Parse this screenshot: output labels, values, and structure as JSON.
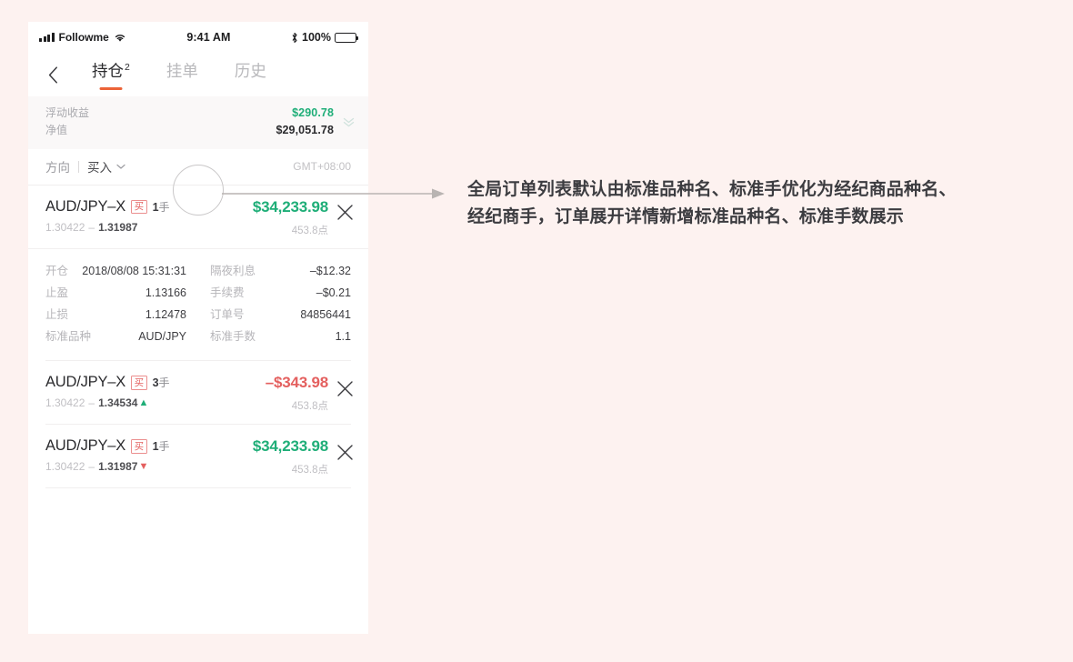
{
  "statusbar": {
    "carrier": "Followme",
    "time": "9:41 AM",
    "battery_percent": "100%",
    "signal_icon": "signal-bars-icon",
    "wifi_icon": "wifi-icon",
    "bluetooth_icon": "bluetooth-icon",
    "battery_icon": "battery-full-icon"
  },
  "nav": {
    "back_icon": "back-chevron-icon",
    "tabs": [
      {
        "label": "持仓",
        "badge": "2",
        "active": true
      },
      {
        "label": "挂单",
        "badge": "",
        "active": false
      },
      {
        "label": "历史",
        "badge": "",
        "active": false
      }
    ]
  },
  "summary": {
    "floating_pnl_label": "浮动收益",
    "floating_pnl_value": "$290.78",
    "equity_label": "净值",
    "equity_value": "$29,051.78",
    "expand_icon": "double-chevron-down-icon",
    "green": "#1fae78"
  },
  "filter": {
    "key": "方向",
    "value": "买入",
    "chevron_icon": "chevron-down-icon",
    "timezone": "GMT+08:00"
  },
  "orders": [
    {
      "symbol": "AUD/JPY–X",
      "side": "买",
      "lots_num": "1",
      "lots_unit": "手",
      "price_open": "1.30422",
      "price_dash": "–",
      "price_close": "1.31987",
      "trend": "",
      "pnl": "$34,233.98",
      "pnl_sign": "positive",
      "pips": "453.8点",
      "close_icon": "close-x-icon",
      "expanded": true,
      "detail": [
        {
          "label": "开仓",
          "value": "2018/08/08 15:31:31"
        },
        {
          "label": "隔夜利息",
          "value": "–$12.32"
        },
        {
          "label": "止盈",
          "value": "1.13166"
        },
        {
          "label": "手续费",
          "value": "–$0.21"
        },
        {
          "label": "止损",
          "value": "1.12478"
        },
        {
          "label": "订单号",
          "value": "84856441"
        },
        {
          "label": "标准品种",
          "value": "AUD/JPY"
        },
        {
          "label": "标准手数",
          "value": "1.1"
        }
      ]
    },
    {
      "symbol": "AUD/JPY–X",
      "side": "买",
      "lots_num": "3",
      "lots_unit": "手",
      "price_open": "1.30422",
      "price_dash": "–",
      "price_close": "1.34534",
      "trend": "up",
      "pnl": "–$343.98",
      "pnl_sign": "negative",
      "pips": "453.8点",
      "close_icon": "close-x-icon",
      "expanded": false
    },
    {
      "symbol": "AUD/JPY–X",
      "side": "买",
      "lots_num": "1",
      "lots_unit": "手",
      "price_open": "1.30422",
      "price_dash": "–",
      "price_close": "1.31987",
      "trend": "down",
      "pnl": "$34,233.98",
      "pnl_sign": "positive",
      "pips": "453.8点",
      "close_icon": "close-x-icon",
      "expanded": false
    }
  ],
  "annotation": {
    "text": "全局订单列表默认由标准品种名、标准手优化为经纪商品种名、经纪商手，订单展开详情新增标准品种名、标准手数展示",
    "circle_icon": "annotation-circle-icon",
    "arrow_icon": "annotation-arrow-icon"
  },
  "colors": {
    "page_bg": "#fdf2f0",
    "positive": "#1fae78",
    "negative": "#e4605f",
    "accent": "#ec6338"
  }
}
